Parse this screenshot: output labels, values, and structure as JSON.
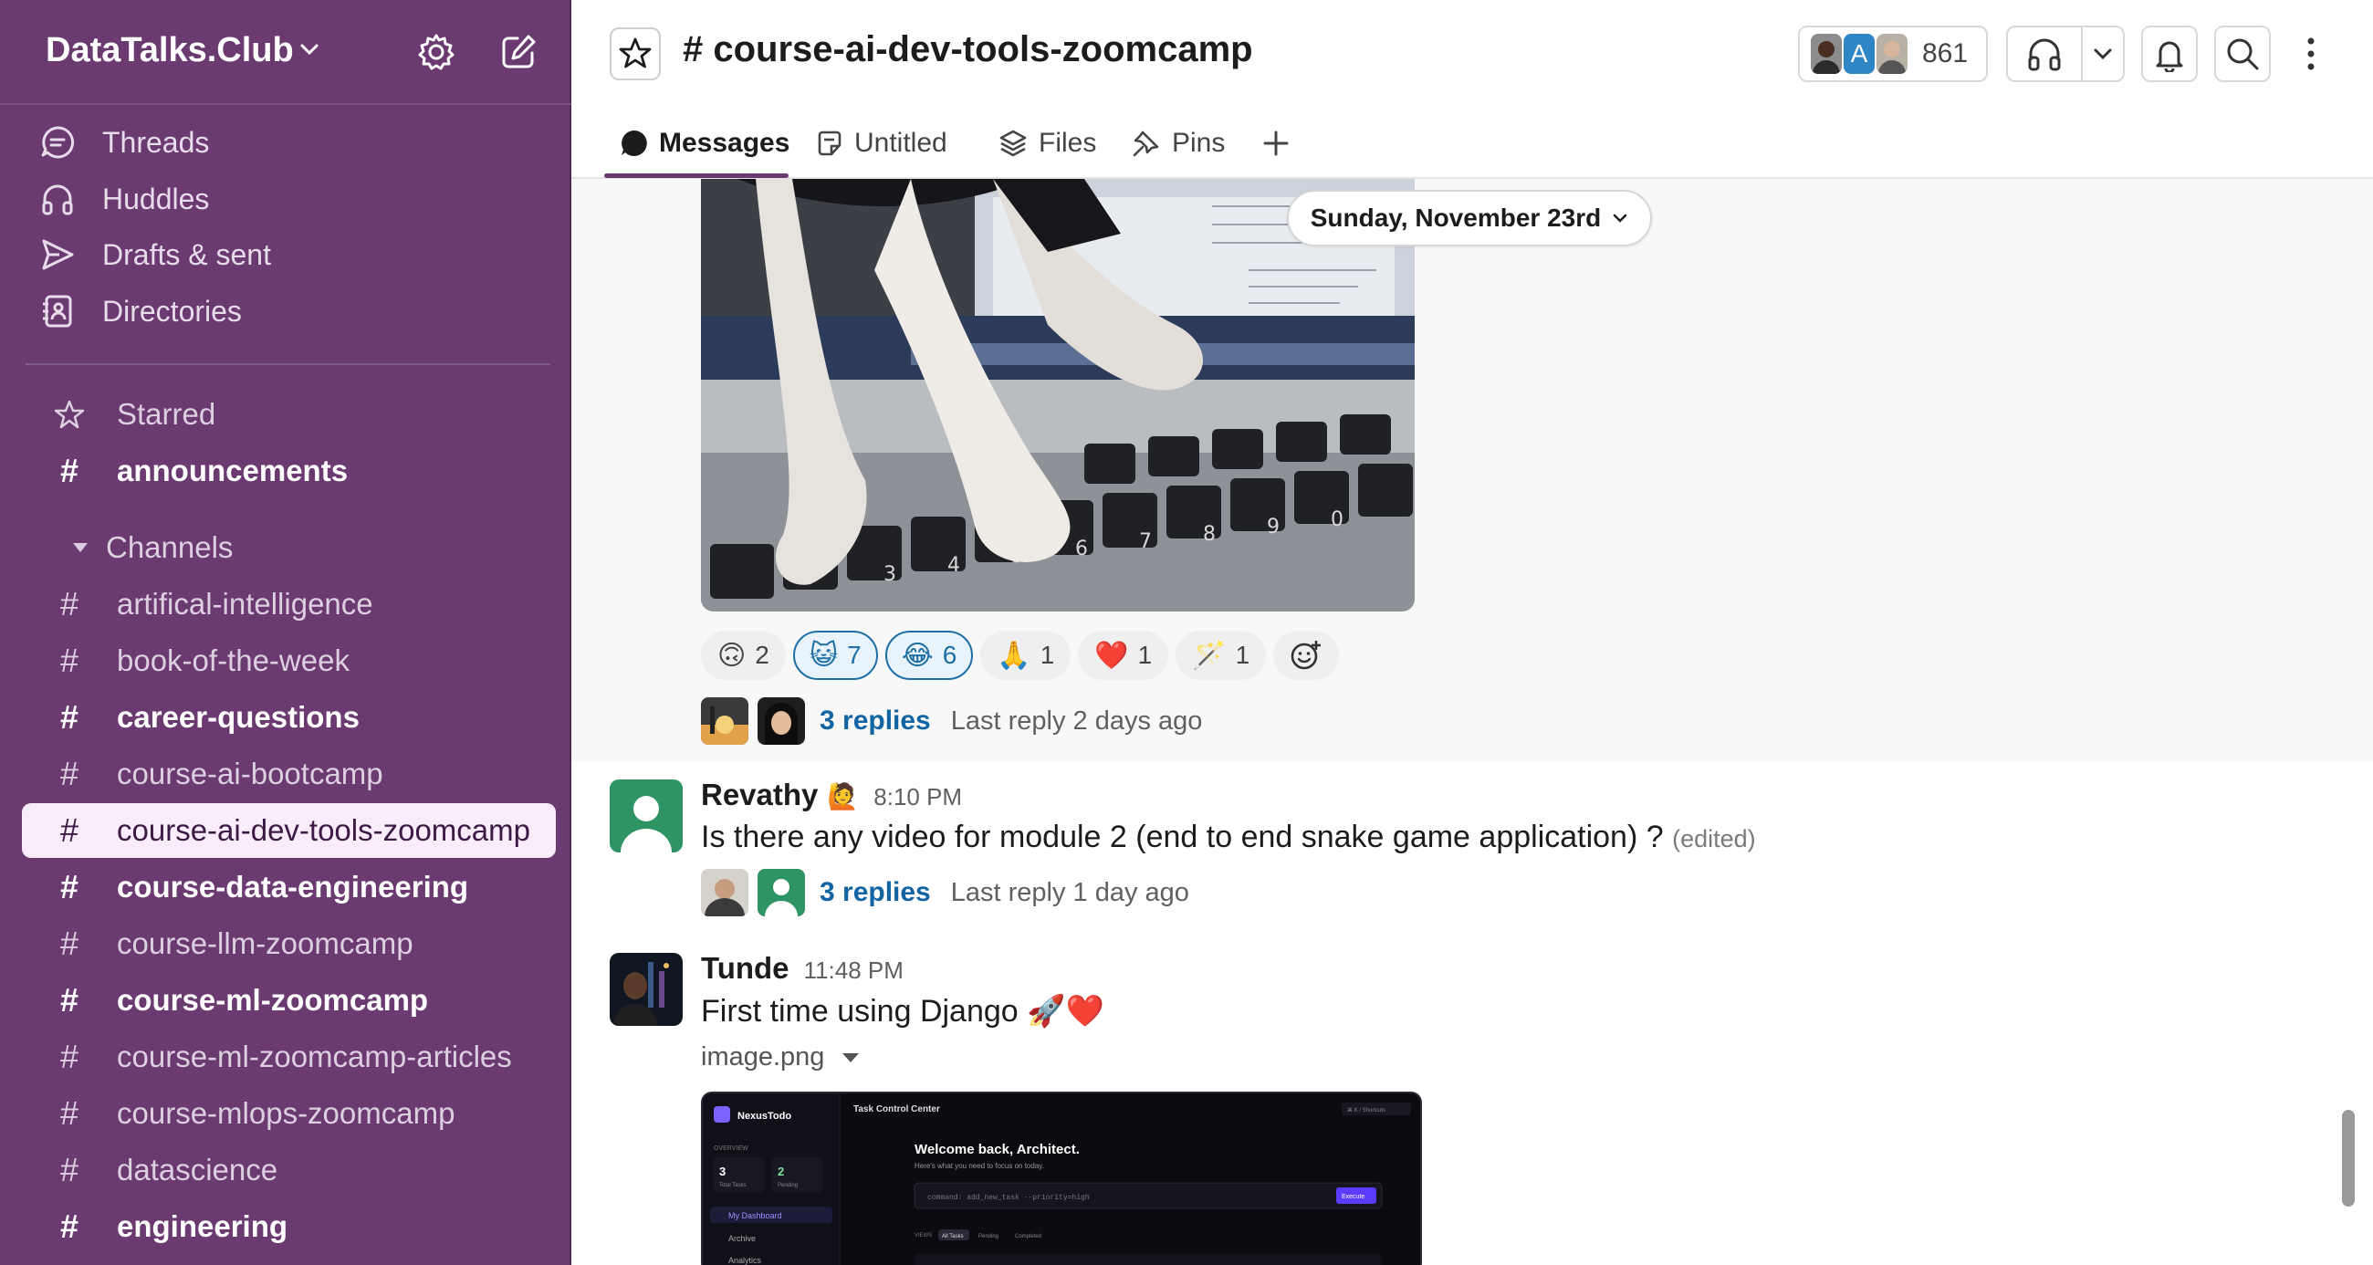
{
  "sidebar": {
    "workspace": "DataTalks.Club",
    "nav": [
      {
        "label": "Threads",
        "icon": "threads-icon"
      },
      {
        "label": "Huddles",
        "icon": "headphones-icon"
      },
      {
        "label": "Drafts & sent",
        "icon": "send-icon"
      },
      {
        "label": "Directories",
        "icon": "directory-icon"
      }
    ],
    "starred_label": "Starred",
    "starred_channel": "announcements",
    "channels_label": "Channels",
    "channels": [
      {
        "name": "artifical-intelligence",
        "unread": false,
        "active": false
      },
      {
        "name": "book-of-the-week",
        "unread": false,
        "active": false
      },
      {
        "name": "career-questions",
        "unread": true,
        "active": false
      },
      {
        "name": "course-ai-bootcamp",
        "unread": false,
        "active": false
      },
      {
        "name": "course-ai-dev-tools-zoomcamp",
        "unread": false,
        "active": true
      },
      {
        "name": "course-data-engineering",
        "unread": true,
        "active": false
      },
      {
        "name": "course-llm-zoomcamp",
        "unread": false,
        "active": false
      },
      {
        "name": "course-ml-zoomcamp",
        "unread": true,
        "active": false
      },
      {
        "name": "course-ml-zoomcamp-articles",
        "unread": false,
        "active": false
      },
      {
        "name": "course-mlops-zoomcamp",
        "unread": false,
        "active": false
      },
      {
        "name": "datascience",
        "unread": false,
        "active": false
      },
      {
        "name": "engineering",
        "unread": true,
        "active": false
      }
    ]
  },
  "header": {
    "channel_title": "# course-ai-dev-tools-zoomcamp",
    "member_count": "861",
    "member_avatar_letter": "A"
  },
  "tabs": [
    {
      "label": "Messages",
      "icon": "message-bubble-icon",
      "active": true
    },
    {
      "label": "Untitled",
      "icon": "canvas-icon",
      "active": false
    },
    {
      "label": "Files",
      "icon": "files-stack-icon",
      "active": false
    },
    {
      "label": "Pins",
      "icon": "pin-icon",
      "active": false
    }
  ],
  "date_divider": "Sunday, November 23rd",
  "reactions": [
    {
      "emoji": "🙃",
      "count": "2",
      "mine": false
    },
    {
      "emoji": "😺",
      "count": "7",
      "mine": true
    },
    {
      "emoji": "😂",
      "count": "6",
      "mine": true
    },
    {
      "emoji": "🙏",
      "count": "1",
      "mine": false
    },
    {
      "emoji": "❤️",
      "count": "1",
      "mine": false
    },
    {
      "emoji": "🪄",
      "count": "1",
      "mine": false
    }
  ],
  "thread1": {
    "replies": "3 replies",
    "last": "Last reply 2 days ago"
  },
  "messages": [
    {
      "author": "Revathy",
      "emoji": "🙋",
      "time": "8:10 PM",
      "text": "Is there any video for module 2 (end to end snake game application) ?",
      "edited": "(edited)",
      "replies": "3 replies",
      "last": "Last reply 1 day ago"
    },
    {
      "author": "Tunde",
      "time": "11:48 PM",
      "text": "First time using Django 🚀❤️",
      "file_name": "image.png"
    }
  ],
  "app_screenshot": {
    "brand": "NexusTodo",
    "page": "Task Control Center",
    "welcome": "Welcome back, Architect.",
    "sub": "Here's what you need to focus on today.",
    "command": "command: add_new_task --priority=high",
    "execute": "Execute",
    "overview": "OVERVIEW",
    "stat1": "3",
    "stat1_label": "Total Tasks",
    "stat2": "2",
    "stat2_label": "Pending",
    "nav1": "My Dashboard",
    "nav2": "Archive",
    "nav3": "Analytics",
    "views": "VIEWS",
    "f1": "All Tasks",
    "f2": "Pending",
    "f3": "Completed",
    "shortcut": "⌘ K  /  Shortcuts"
  }
}
